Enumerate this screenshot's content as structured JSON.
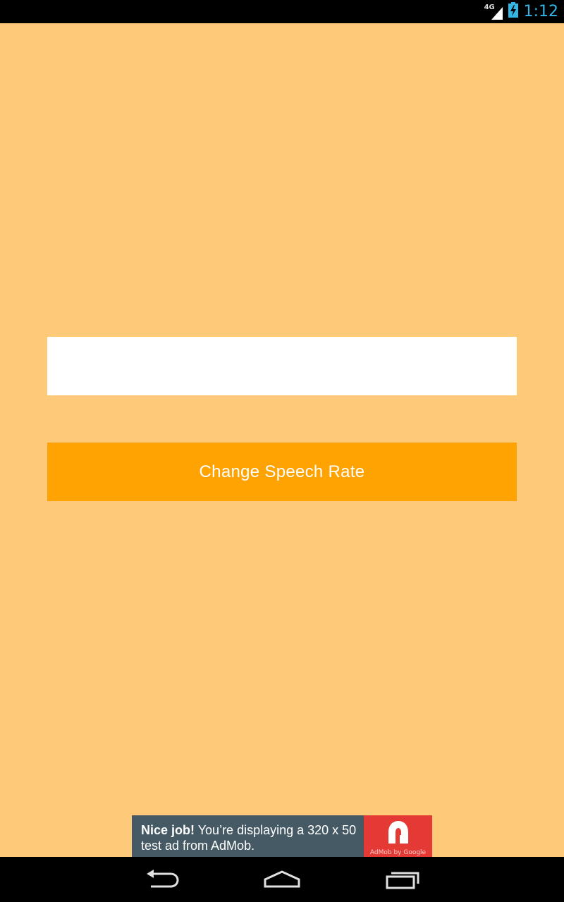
{
  "status_bar": {
    "network_label": "4G",
    "time": "1:12",
    "icons": [
      "signal-icon",
      "battery-charging-icon"
    ]
  },
  "main": {
    "text_input": {
      "value": "",
      "placeholder": ""
    },
    "speech_rate_button_label": "Change Speech Rate"
  },
  "ad": {
    "headline": "Nice job!",
    "body": " You’re displaying a 320 x 50 test ad from AdMob.",
    "logo_caption": "AdMob by Google",
    "logo_icon": "admob-logo-icon"
  },
  "nav_bar": {
    "buttons": [
      "back-icon",
      "home-icon",
      "recent-apps-icon"
    ]
  },
  "colors": {
    "background": "#ffc97a",
    "button": "#ffa303",
    "ad_background": "#455a64",
    "ad_logo": "#e53935",
    "clock": "#33b5e5"
  }
}
